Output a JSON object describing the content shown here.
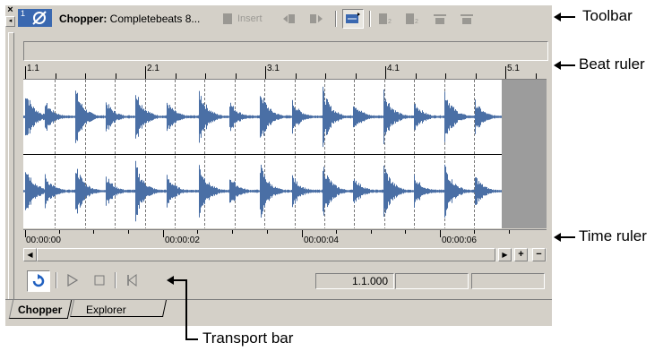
{
  "toolbar": {
    "track_number": "1",
    "title_bold": "Chopper:",
    "title_file": "Completebeats 8...",
    "insert_label": "Insert"
  },
  "beat_ruler": {
    "marks": [
      "1.1",
      "2.1",
      "3.1",
      "4.1",
      "5.1"
    ]
  },
  "time_ruler": {
    "marks": [
      "00:00:00",
      "00:00:02",
      "00:00:04",
      "00:00:06"
    ]
  },
  "transport": {
    "position": "1.1.000",
    "field2": "",
    "field3": ""
  },
  "tabs": [
    {
      "label": "Chopper",
      "active": true
    },
    {
      "label": "Explorer",
      "active": false
    }
  ],
  "callouts": {
    "toolbar": "Toolbar",
    "beat_ruler": "Beat ruler",
    "time_ruler": "Time ruler",
    "transport_bar": "Transport bar"
  },
  "colors": {
    "waveform": "#4a6fa5",
    "selection_fill": "#9c9c9c",
    "window_bg": "#d4d0c8",
    "accent": "#2060c0"
  }
}
